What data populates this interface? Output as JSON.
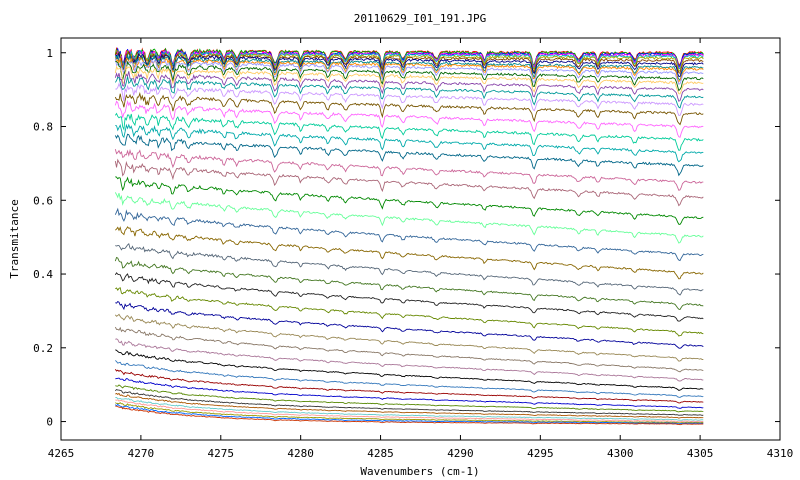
{
  "chart_data": {
    "type": "line",
    "title": "20110629_I01_191.JPG",
    "xlabel": "Wavenumbers (cm-1)",
    "ylabel": "Transmitance",
    "xlim": [
      4265,
      4310
    ],
    "ylim": [
      -0.05,
      1.04
    ],
    "x_range": [
      4268.4,
      4305.2
    ],
    "xticks": [
      "4265",
      "4270",
      "4275",
      "4280",
      "4285",
      "4290",
      "4295",
      "4300",
      "4305",
      "4310"
    ],
    "yticks": [
      "0",
      "0.2",
      "0.4",
      "0.6",
      "0.8",
      "1"
    ],
    "absorption_lines": [
      4268.9,
      4269.6,
      4270.4,
      4271.1,
      4272.0,
      4273.0,
      4275.2,
      4276.0,
      4278.4,
      4280.0,
      4281.7,
      4282.8,
      4285.1,
      4286.4,
      4288.5,
      4291.5,
      4294.6,
      4297.4,
      4298.6,
      4300.9,
      4303.7
    ],
    "grid": false,
    "legend": "none",
    "series": [
      {
        "color": "#ff0000",
        "start": 1.005,
        "end": 1.0
      },
      {
        "color": "#00aa00",
        "start": 1.005,
        "end": 0.998
      },
      {
        "color": "#0000ff",
        "start": 1.0,
        "end": 0.996
      },
      {
        "color": "#ff00ff",
        "start": 1.0,
        "end": 0.993
      },
      {
        "color": "#00bbbb",
        "start": 0.998,
        "end": 0.99
      },
      {
        "color": "#aaaa00",
        "start": 0.995,
        "end": 0.985
      },
      {
        "color": "#884400",
        "start": 0.993,
        "end": 0.978
      },
      {
        "color": "#000088",
        "start": 0.99,
        "end": 0.97
      },
      {
        "color": "#008888",
        "start": 0.985,
        "end": 0.96
      },
      {
        "color": "#ff8800",
        "start": 0.98,
        "end": 0.955
      },
      {
        "color": "#9999ff",
        "start": 0.975,
        "end": 0.945
      },
      {
        "color": "#006600",
        "start": 0.965,
        "end": 0.93
      },
      {
        "color": "#ffcc66",
        "start": 0.955,
        "end": 0.918
      },
      {
        "color": "#8844aa",
        "start": 0.94,
        "end": 0.9
      },
      {
        "color": "#009999",
        "start": 0.925,
        "end": 0.88
      },
      {
        "color": "#cc99ff",
        "start": 0.905,
        "end": 0.86
      },
      {
        "color": "#775500",
        "start": 0.88,
        "end": 0.835
      },
      {
        "color": "#ff66ff",
        "start": 0.855,
        "end": 0.8
      },
      {
        "color": "#00cc99",
        "start": 0.825,
        "end": 0.765
      },
      {
        "color": "#00aaaa",
        "start": 0.795,
        "end": 0.73
      },
      {
        "color": "#006688",
        "start": 0.765,
        "end": 0.695
      },
      {
        "color": "#cc6699",
        "start": 0.725,
        "end": 0.65
      },
      {
        "color": "#aa6677",
        "start": 0.69,
        "end": 0.61
      },
      {
        "color": "#008800",
        "start": 0.645,
        "end": 0.555
      },
      {
        "color": "#66ff99",
        "start": 0.6,
        "end": 0.505
      },
      {
        "color": "#336699",
        "start": 0.555,
        "end": 0.455
      },
      {
        "color": "#886600",
        "start": 0.51,
        "end": 0.405
      },
      {
        "color": "#556677",
        "start": 0.465,
        "end": 0.36
      },
      {
        "color": "#447722",
        "start": 0.42,
        "end": 0.32
      },
      {
        "color": "#222222",
        "start": 0.38,
        "end": 0.285
      },
      {
        "color": "#668800",
        "start": 0.34,
        "end": 0.245
      },
      {
        "color": "#000099",
        "start": 0.3,
        "end": 0.21
      },
      {
        "color": "#998855",
        "start": 0.265,
        "end": 0.175
      },
      {
        "color": "#887766",
        "start": 0.23,
        "end": 0.145
      },
      {
        "color": "#aa7799",
        "start": 0.195,
        "end": 0.12
      },
      {
        "color": "#000000",
        "start": 0.165,
        "end": 0.095
      },
      {
        "color": "#3377bb",
        "start": 0.135,
        "end": 0.075
      },
      {
        "color": "#990000",
        "start": 0.11,
        "end": 0.06
      },
      {
        "color": "#0000cc",
        "start": 0.09,
        "end": 0.045
      },
      {
        "color": "#558800",
        "start": 0.07,
        "end": 0.035
      },
      {
        "color": "#333333",
        "start": 0.055,
        "end": 0.025
      },
      {
        "color": "#aa5500",
        "start": 0.045,
        "end": 0.018
      },
      {
        "color": "#66cccc",
        "start": 0.035,
        "end": 0.012
      },
      {
        "color": "#ff9999",
        "start": 0.028,
        "end": 0.008
      },
      {
        "color": "#999900",
        "start": 0.02,
        "end": 0.005
      },
      {
        "color": "#0066ff",
        "start": 0.014,
        "end": 0.003
      },
      {
        "color": "#cc3300",
        "start": 0.009,
        "end": 0.001
      }
    ]
  }
}
